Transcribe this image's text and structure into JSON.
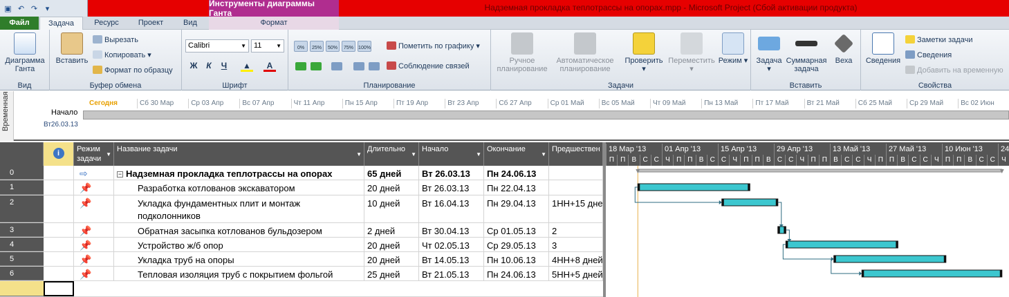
{
  "window": {
    "context_group": "Инструменты диаграммы Ганта",
    "title": "Надземная прокладка теплотрассы на опорах.mpp  -  Microsoft Project (Сбой активации продукта)"
  },
  "tabs": [
    "Файл",
    "Задача",
    "Ресурс",
    "Проект",
    "Вид",
    "Формат"
  ],
  "ribbon": {
    "view": {
      "gantt": "Диаграмма Ганта",
      "group": "Вид"
    },
    "clipboard": {
      "paste": "Вставить",
      "cut": "Вырезать",
      "copy": "Копировать",
      "format_painter": "Формат по образцу",
      "group": "Буфер обмена"
    },
    "font": {
      "family": "Calibri",
      "size": "11",
      "bold": "Ж",
      "italic": "К",
      "underline": "Ч",
      "group": "Шрифт"
    },
    "schedule": {
      "pct": [
        "0%",
        "25%",
        "50%",
        "75%",
        "100%"
      ],
      "mark_on_track": "Пометить по графику",
      "respect_links": "Соблюдение связей",
      "group": "Планирование"
    },
    "tasks": {
      "manual": "Ручное планирование",
      "auto": "Автоматическое планирование",
      "inspect": "Проверить",
      "move": "Переместить",
      "mode": "Режим",
      "group": "Задачи"
    },
    "insert": {
      "task": "Задача",
      "summary": "Суммарная задача",
      "milestone": "Веха",
      "group": "Вставить"
    },
    "properties": {
      "info": "Сведения",
      "notes": "Заметки задачи",
      "details": "Сведения",
      "add_timeline": "Добавить на временную",
      "group": "Свойства"
    }
  },
  "timeline": {
    "side_label": "Временная",
    "today": "Сегодня",
    "dates": [
      "Сб 30 Мар",
      "Ср 03 Апр",
      "Вс 07 Апр",
      "Чт 11 Апр",
      "Пн 15 Апр",
      "Пт 19 Апр",
      "Вт 23 Апр",
      "Сб 27 Апр",
      "Ср 01 Май",
      "Вс 05 Май",
      "Чт 09 Май",
      "Пн 13 Май",
      "Пт 17 Май",
      "Вт 21 Май",
      "Сб 25 Май",
      "Ср 29 Май",
      "Вс 02 Июн"
    ],
    "start_label": "Начало",
    "start_date": "Вт26.03.13"
  },
  "columns": {
    "info": "i",
    "mode": "Режим задачи",
    "name": "Название задачи",
    "duration": "Длительно",
    "start": "Начало",
    "finish": "Окончание",
    "pred": "Предшествен"
  },
  "tasks": [
    {
      "id": "0",
      "name": "Надземная прокладка теплотрассы на опорах",
      "duration": "65 дней",
      "start": "Вт 26.03.13",
      "finish": "Пн 24.06.13",
      "pred": "",
      "summary": true
    },
    {
      "id": "1",
      "name": "Разработка котлованов экскаватором",
      "duration": "20 дней",
      "start": "Вт 26.03.13",
      "finish": "Пн 22.04.13",
      "pred": ""
    },
    {
      "id": "2",
      "name": "Укладка фундаментных плит и монтаж",
      "name2": "подколонников",
      "duration": "10 дней",
      "start": "Вт 16.04.13",
      "finish": "Пн 29.04.13",
      "pred": "1НН+15 дне"
    },
    {
      "id": "3",
      "name": "Обратная засыпка котлованов бульдозером",
      "duration": "2 дней",
      "start": "Вт 30.04.13",
      "finish": "Ср 01.05.13",
      "pred": "2"
    },
    {
      "id": "4",
      "name": "Устройство ж/б опор",
      "duration": "20 дней",
      "start": "Чт 02.05.13",
      "finish": "Ср 29.05.13",
      "pred": "3"
    },
    {
      "id": "5",
      "name": "Укладка труб на опоры",
      "duration": "20 дней",
      "start": "Вт 14.05.13",
      "finish": "Пн 10.06.13",
      "pred": "4НН+8 дней"
    },
    {
      "id": "6",
      "name": "Тепловая изоляция труб с покрытием фольгой",
      "duration": "25 дней",
      "start": "Вт 21.05.13",
      "finish": "Пн 24.06.13",
      "pred": "5НН+5 дней"
    }
  ],
  "gantt": {
    "weeks": [
      "18 Мар '13",
      "01 Апр '13",
      "15 Апр '13",
      "29 Апр '13",
      "13 Май '13",
      "27 Май '13",
      "10 Июн '13",
      "24"
    ],
    "days": [
      "П",
      "П",
      "В",
      "С",
      "С",
      "Ч",
      "П",
      "П",
      "В",
      "С",
      "С",
      "Ч",
      "П",
      "П",
      "В",
      "С",
      "С",
      "Ч",
      "П",
      "П",
      "В",
      "С",
      "С",
      "Ч",
      "П",
      "П",
      "В",
      "С",
      "С",
      "Ч",
      "П",
      "П",
      "В",
      "С",
      "С",
      "Ч"
    ],
    "bar_color": "#3cc7cf"
  }
}
